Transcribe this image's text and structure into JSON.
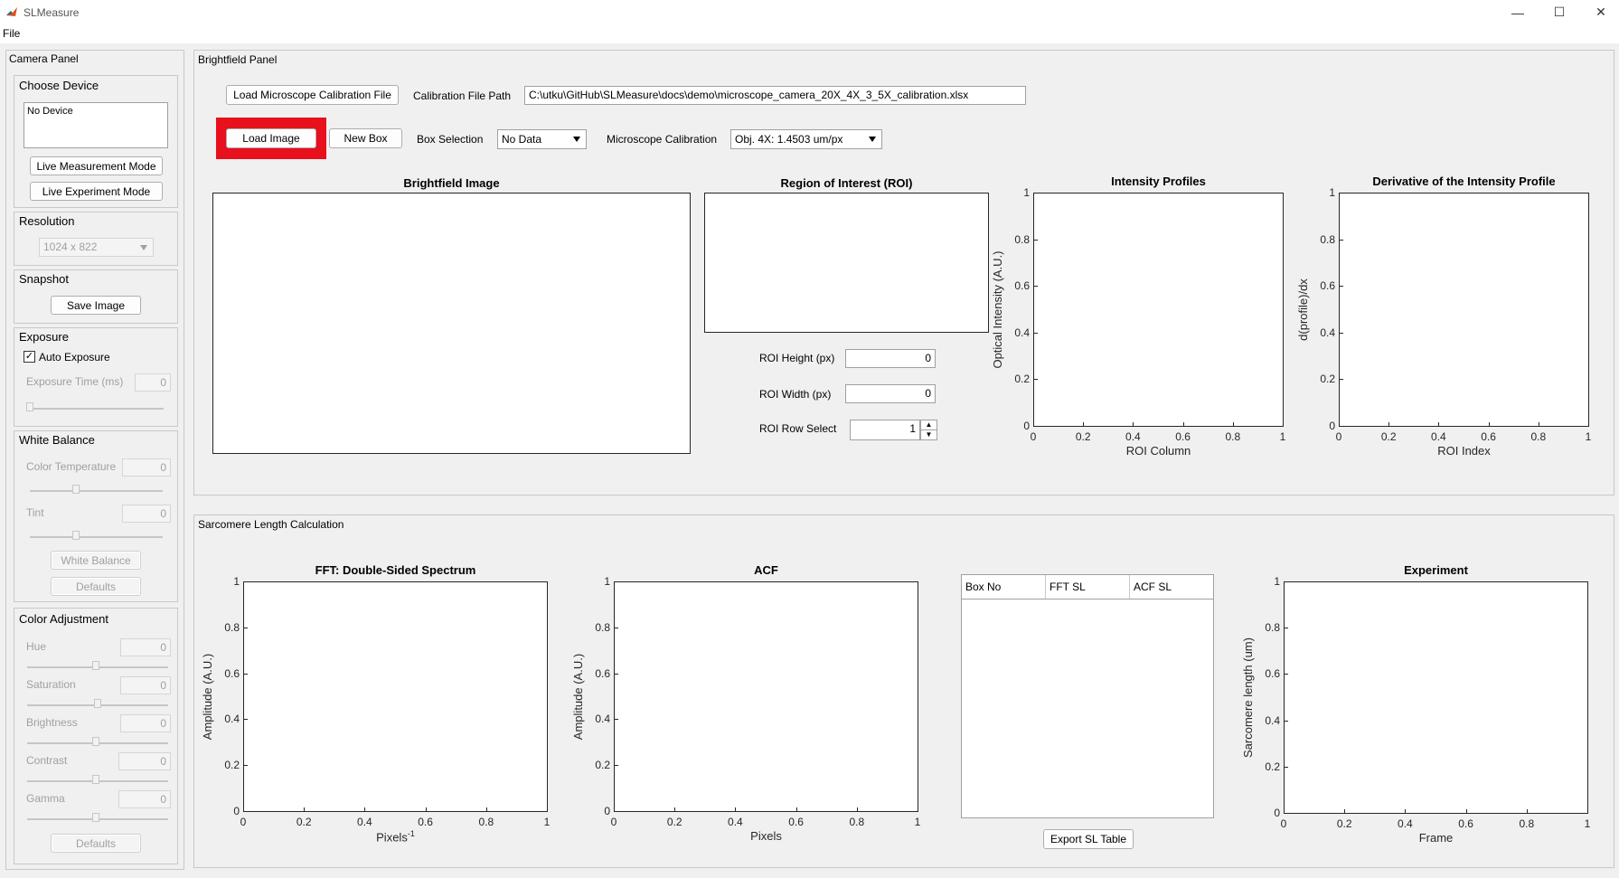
{
  "window": {
    "title": "SLMeasure",
    "minimize": "—",
    "maximize": "☐",
    "close": "✕"
  },
  "menu": {
    "file": "File"
  },
  "camera_panel": {
    "title": "Camera Panel",
    "choose_device": {
      "title": "Choose Device",
      "device_list": [
        "No Device"
      ],
      "live_measurement": "Live Measurement Mode",
      "live_experiment": "Live Experiment Mode"
    },
    "resolution": {
      "title": "Resolution",
      "value": "1024 x 822"
    },
    "snapshot": {
      "title": "Snapshot",
      "save_image": "Save Image"
    },
    "exposure": {
      "title": "Exposure",
      "auto_label": "Auto Exposure",
      "auto_checked": true,
      "time_label": "Exposure Time (ms)",
      "time_value": "0"
    },
    "white_balance": {
      "title": "White Balance",
      "color_temp_label": "Color Temperature",
      "color_temp_value": "0",
      "tint_label": "Tint",
      "tint_value": "0",
      "wb_button": "White Balance",
      "defaults": "Defaults"
    },
    "color_adjustment": {
      "title": "Color Adjustment",
      "hue_label": "Hue",
      "hue_value": "0",
      "saturation_label": "Saturation",
      "saturation_value": "0",
      "brightness_label": "Brightness",
      "brightness_value": "0",
      "contrast_label": "Contrast",
      "contrast_value": "0",
      "gamma_label": "Gamma",
      "gamma_value": "0",
      "defaults": "Defaults"
    }
  },
  "brightfield": {
    "title": "Brightfield Panel",
    "load_calibration": "Load Microscope Calibration File",
    "calib_path_label": "Calibration File Path",
    "calib_path": "C:\\utku\\GitHub\\SLMeasure\\docs\\demo\\microscope_camera_20X_4X_3_5X_calibration.xlsx",
    "load_image": "Load Image",
    "new_box": "New Box",
    "box_selection_label": "Box Selection",
    "box_selection_value": "No Data",
    "mic_calib_label": "Microscope Calibration",
    "mic_calib_value": "Obj. 4X: 1.4503 um/px",
    "image_title": "Brightfield Image",
    "roi_title": "Region of Interest (ROI)",
    "roi_height_label": "ROI Height (px)",
    "roi_height_value": "0",
    "roi_width_label": "ROI Width (px)",
    "roi_width_value": "0",
    "roi_row_label": "ROI Row Select",
    "roi_row_value": "1",
    "intensity": {
      "title": "Intensity Profiles",
      "xlabel": "ROI Column",
      "ylabel": "Optical Intensity (A.U.)"
    },
    "derivative": {
      "title": "Derivative of the Intensity Profile",
      "xlabel": "ROI Index",
      "ylabel": "d(profile)/dx"
    }
  },
  "sarcomere": {
    "title": "Sarcomere Length Calculation",
    "fft": {
      "title": "FFT: Double-Sided Spectrum",
      "xlabel": "Pixels",
      "xlabel_sup": "-1",
      "ylabel": "Amplitude (A.U.)"
    },
    "acf": {
      "title": "ACF",
      "xlabel": "Pixels",
      "ylabel": "Amplitude (A.U.)"
    },
    "table": {
      "columns": [
        "Box No",
        "FFT SL",
        "ACF SL"
      ]
    },
    "export": "Export SL Table",
    "experiment": {
      "title": "Experiment",
      "xlabel": "Frame",
      "ylabel": "Sarcomere length (um)"
    }
  },
  "ticks": {
    "x": [
      "0",
      "0.2",
      "0.4",
      "0.6",
      "0.8",
      "1"
    ],
    "y": [
      "0",
      "0.2",
      "0.4",
      "0.6",
      "0.8",
      "1"
    ]
  },
  "colors": {
    "highlight": "#e8101c",
    "axes": "#262626"
  }
}
